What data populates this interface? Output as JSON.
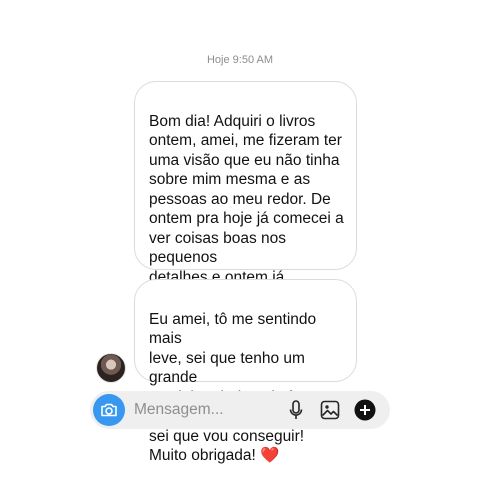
{
  "timestamp": "Hoje 9:50 AM",
  "messages": [
    {
      "text": "Bom dia! Adquiri o livros\nontem, amei, me fizeram ter\numa visão que eu não tinha\nsobre mim mesma e as\npessoas ao meu redor. De\nontem pra hoje já comecei a\nver coisas boas nos pequenos\ndetalhes e ontem já consegui\ndesligar a minha mente para\ndormir, com as dicas"
    },
    {
      "text": "Eu amei, tô me sentindo mais\nleve, sei que tenho um grande\ncaminho ainda pela frente, mas\nsei que vou conseguir!\nMuito obrigada! ",
      "emoji": "❤️"
    }
  ],
  "composer": {
    "placeholder": "Mensagem...",
    "icons": [
      "camera-icon",
      "microphone-icon",
      "gallery-icon",
      "plus-icon"
    ]
  },
  "colors": {
    "accent": "#3897f0",
    "bubble_border": "#dbdbdb",
    "composer_bg": "#efefef",
    "timestamp": "#8e8e8e",
    "heart": "#e0245e"
  }
}
